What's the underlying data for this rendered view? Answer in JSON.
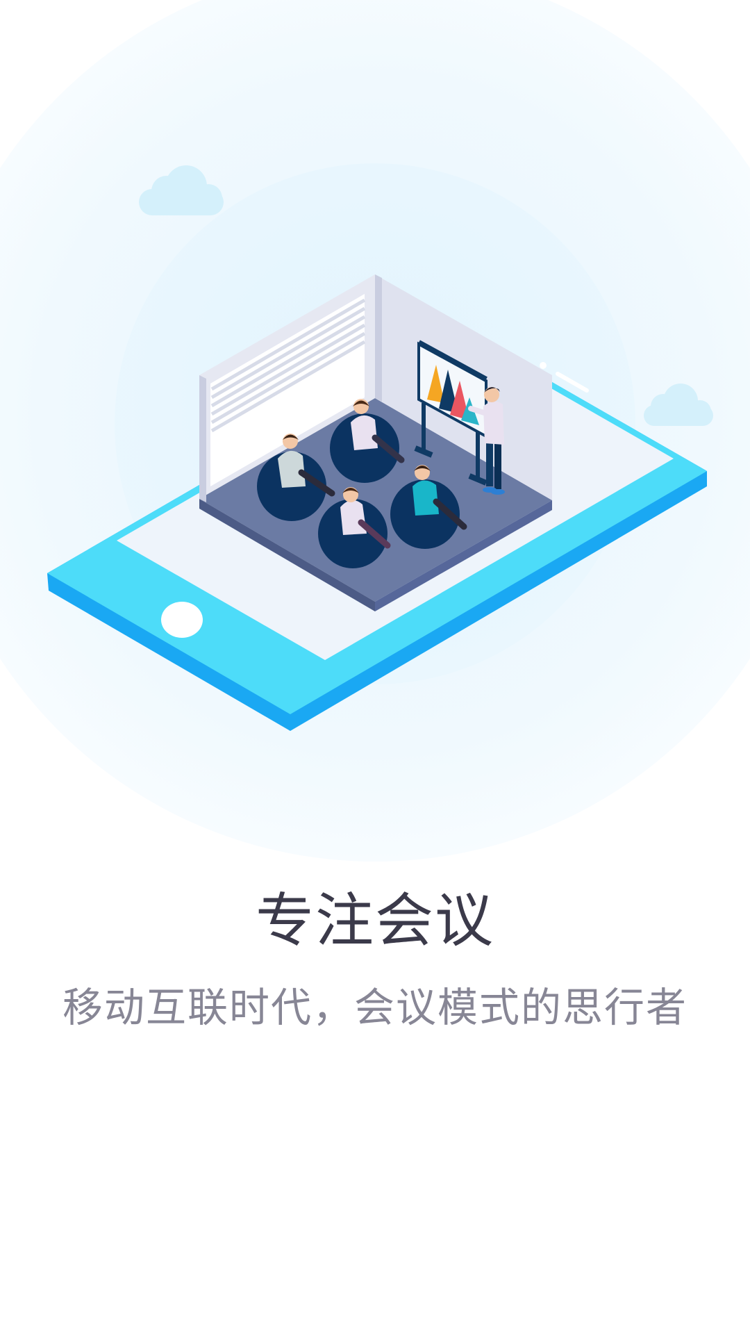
{
  "onboarding": {
    "title": "专注会议",
    "subtitle": "移动互联时代，会议模式的思行者"
  },
  "illustration": {
    "subject": "isometric meeting room on a smartphone",
    "icons": [
      "cloud-icon",
      "smartphone",
      "presentation-board",
      "beanbag-chair"
    ]
  },
  "colors": {
    "background": "#ffffff",
    "circle_light": "#eef8fe",
    "phone_blue": "#1aa8f3",
    "phone_cyan": "#4ddcf9",
    "floor": "#6b7ba4",
    "beanbag": "#0b3361",
    "title_text": "#3b3a4a",
    "subtitle_text": "#878695"
  }
}
